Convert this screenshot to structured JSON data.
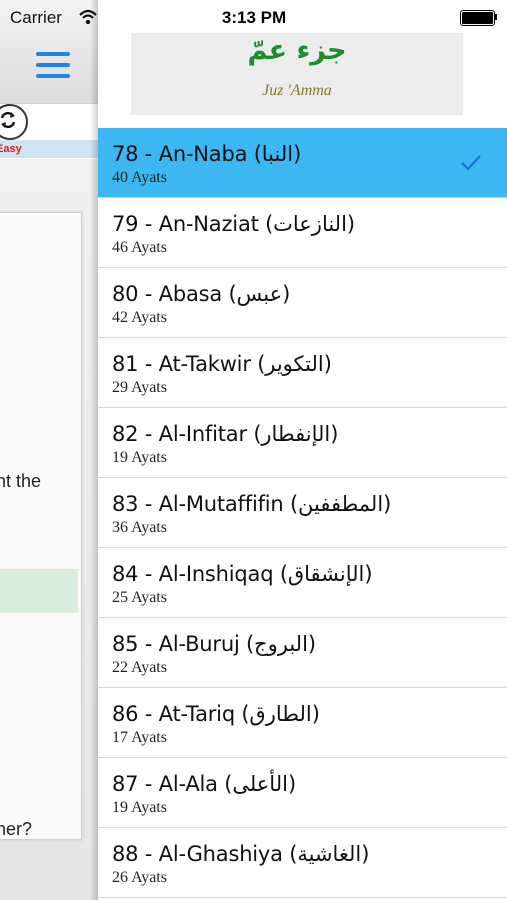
{
  "background_view": {
    "carrier": "Carrier",
    "badge_text": "Easy",
    "snippet_1": "nt the",
    "snippet_2": "her?"
  },
  "status_bar": {
    "time": "3:13 PM"
  },
  "header": {
    "title_arabic": "جزء عمّ",
    "title_english": "Juz 'Amma"
  },
  "colors": {
    "selected_row": "#3db7f2",
    "menu_icon": "#1f86e8",
    "arabic_title": "#1f8c2c"
  },
  "surahs": [
    {
      "title": "78 - An-Naba (النبا)",
      "ayats": "40 Ayats",
      "selected": true
    },
    {
      "title": "79 - An-Naziat (النازعات)",
      "ayats": "46 Ayats",
      "selected": false
    },
    {
      "title": "80 - Abasa (عبس)",
      "ayats": "42 Ayats",
      "selected": false
    },
    {
      "title": "81 - At-Takwir (التكوير)",
      "ayats": "29 Ayats",
      "selected": false
    },
    {
      "title": "82 - Al-Infitar (الإنفطار)",
      "ayats": "19 Ayats",
      "selected": false
    },
    {
      "title": "83 - Al-Mutaffifin (المطففين)",
      "ayats": "36 Ayats",
      "selected": false
    },
    {
      "title": "84 - Al-Inshiqaq (الإنشقاق)",
      "ayats": "25 Ayats",
      "selected": false
    },
    {
      "title": "85 - Al-Buruj (البروج)",
      "ayats": "22 Ayats",
      "selected": false
    },
    {
      "title": "86 - At-Tariq (الطارق)",
      "ayats": "17 Ayats",
      "selected": false
    },
    {
      "title": "87 - Al-Ala (الأعلى)",
      "ayats": "19 Ayats",
      "selected": false
    },
    {
      "title": "88 - Al-Ghashiya (الغاشية)",
      "ayats": "26 Ayats",
      "selected": false
    }
  ]
}
